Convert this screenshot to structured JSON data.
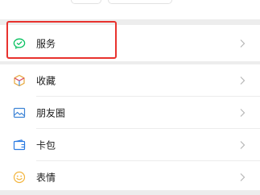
{
  "menu": {
    "services": {
      "label": "服务",
      "icon": "services-check-icon",
      "color": "#07c160"
    },
    "items": [
      {
        "label": "收藏",
        "icon": "favorites-cube-icon",
        "color": "#e7a73b"
      },
      {
        "label": "朋友圈",
        "icon": "moments-photo-icon",
        "color": "#3d84d6"
      },
      {
        "label": "卡包",
        "icon": "card-wallet-icon",
        "color": "#2a7ae2"
      },
      {
        "label": "表情",
        "icon": "sticker-smile-icon",
        "color": "#f3b43b"
      }
    ]
  },
  "colors": {
    "background": "#ededed",
    "card": "#ffffff",
    "highlight": "#e8322e",
    "arrow": "#b7b7b7"
  }
}
